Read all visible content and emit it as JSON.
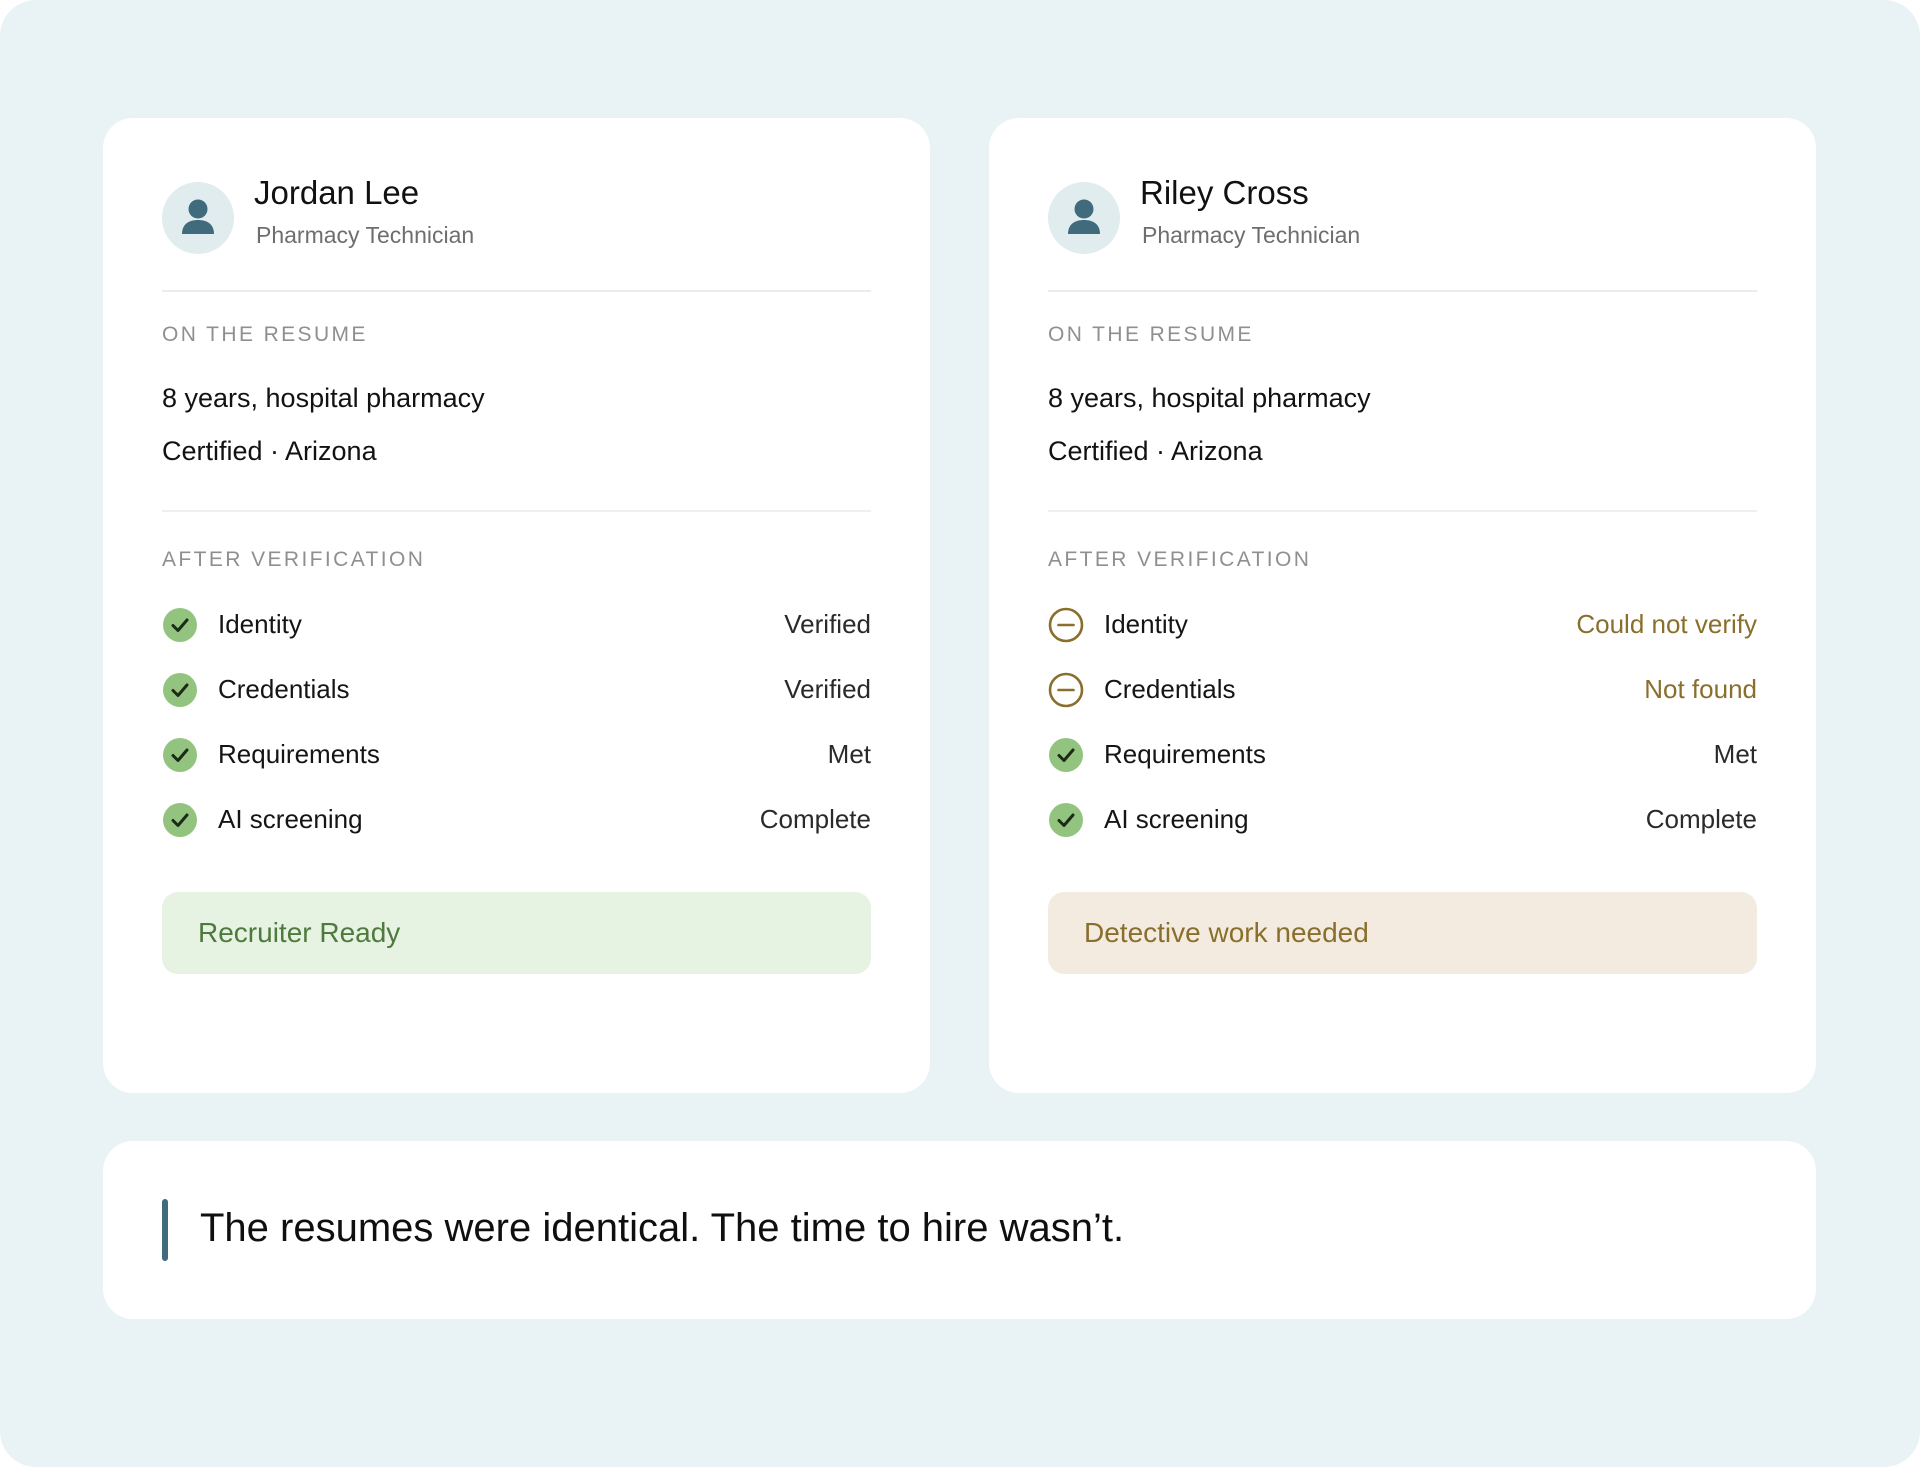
{
  "candidates": [
    {
      "name": "Jordan Lee",
      "role": "Pharmacy Technician",
      "avatar_icon": "person-icon",
      "resume_label": "ON THE RESUME",
      "resume_lines": [
        "8 years, hospital pharmacy",
        "Certified · Arizona"
      ],
      "verification_label": "AFTER VERIFICATION",
      "checks": [
        {
          "label": "Identity",
          "value": "Verified",
          "status": "ok",
          "icon": "check-circle-icon"
        },
        {
          "label": "Credentials",
          "value": "Verified",
          "status": "ok",
          "icon": "check-circle-icon"
        },
        {
          "label": "Requirements",
          "value": "Met",
          "status": "ok",
          "icon": "check-circle-icon"
        },
        {
          "label": "AI screening",
          "value": "Complete",
          "status": "ok",
          "icon": "check-circle-icon"
        }
      ],
      "verdict": "Recruiter Ready",
      "verdict_status": "good"
    },
    {
      "name": "Riley Cross",
      "role": "Pharmacy Technician",
      "avatar_icon": "person-icon",
      "resume_label": "ON THE RESUME",
      "resume_lines": [
        "8 years, hospital pharmacy",
        "Certified · Arizona"
      ],
      "verification_label": "AFTER VERIFICATION",
      "checks": [
        {
          "label": "Identity",
          "value": "Could not verify",
          "status": "warn",
          "icon": "minus-circle-icon"
        },
        {
          "label": "Credentials",
          "value": "Not found",
          "status": "warn",
          "icon": "minus-circle-icon"
        },
        {
          "label": "Requirements",
          "value": "Met",
          "status": "ok",
          "icon": "check-circle-icon"
        },
        {
          "label": "AI screening",
          "value": "Complete",
          "status": "ok",
          "icon": "check-circle-icon"
        }
      ],
      "verdict": "Detective work needed",
      "verdict_status": "bad"
    }
  ],
  "quote": "The resumes were identical. The time to hire wasn’t.",
  "colors": {
    "background": "#e9f2f5",
    "ok_green": "#92c47f",
    "warn_brown": "#8a6f2c",
    "good_text": "#4f7a3d",
    "accent_bar": "#3f6b7d"
  }
}
